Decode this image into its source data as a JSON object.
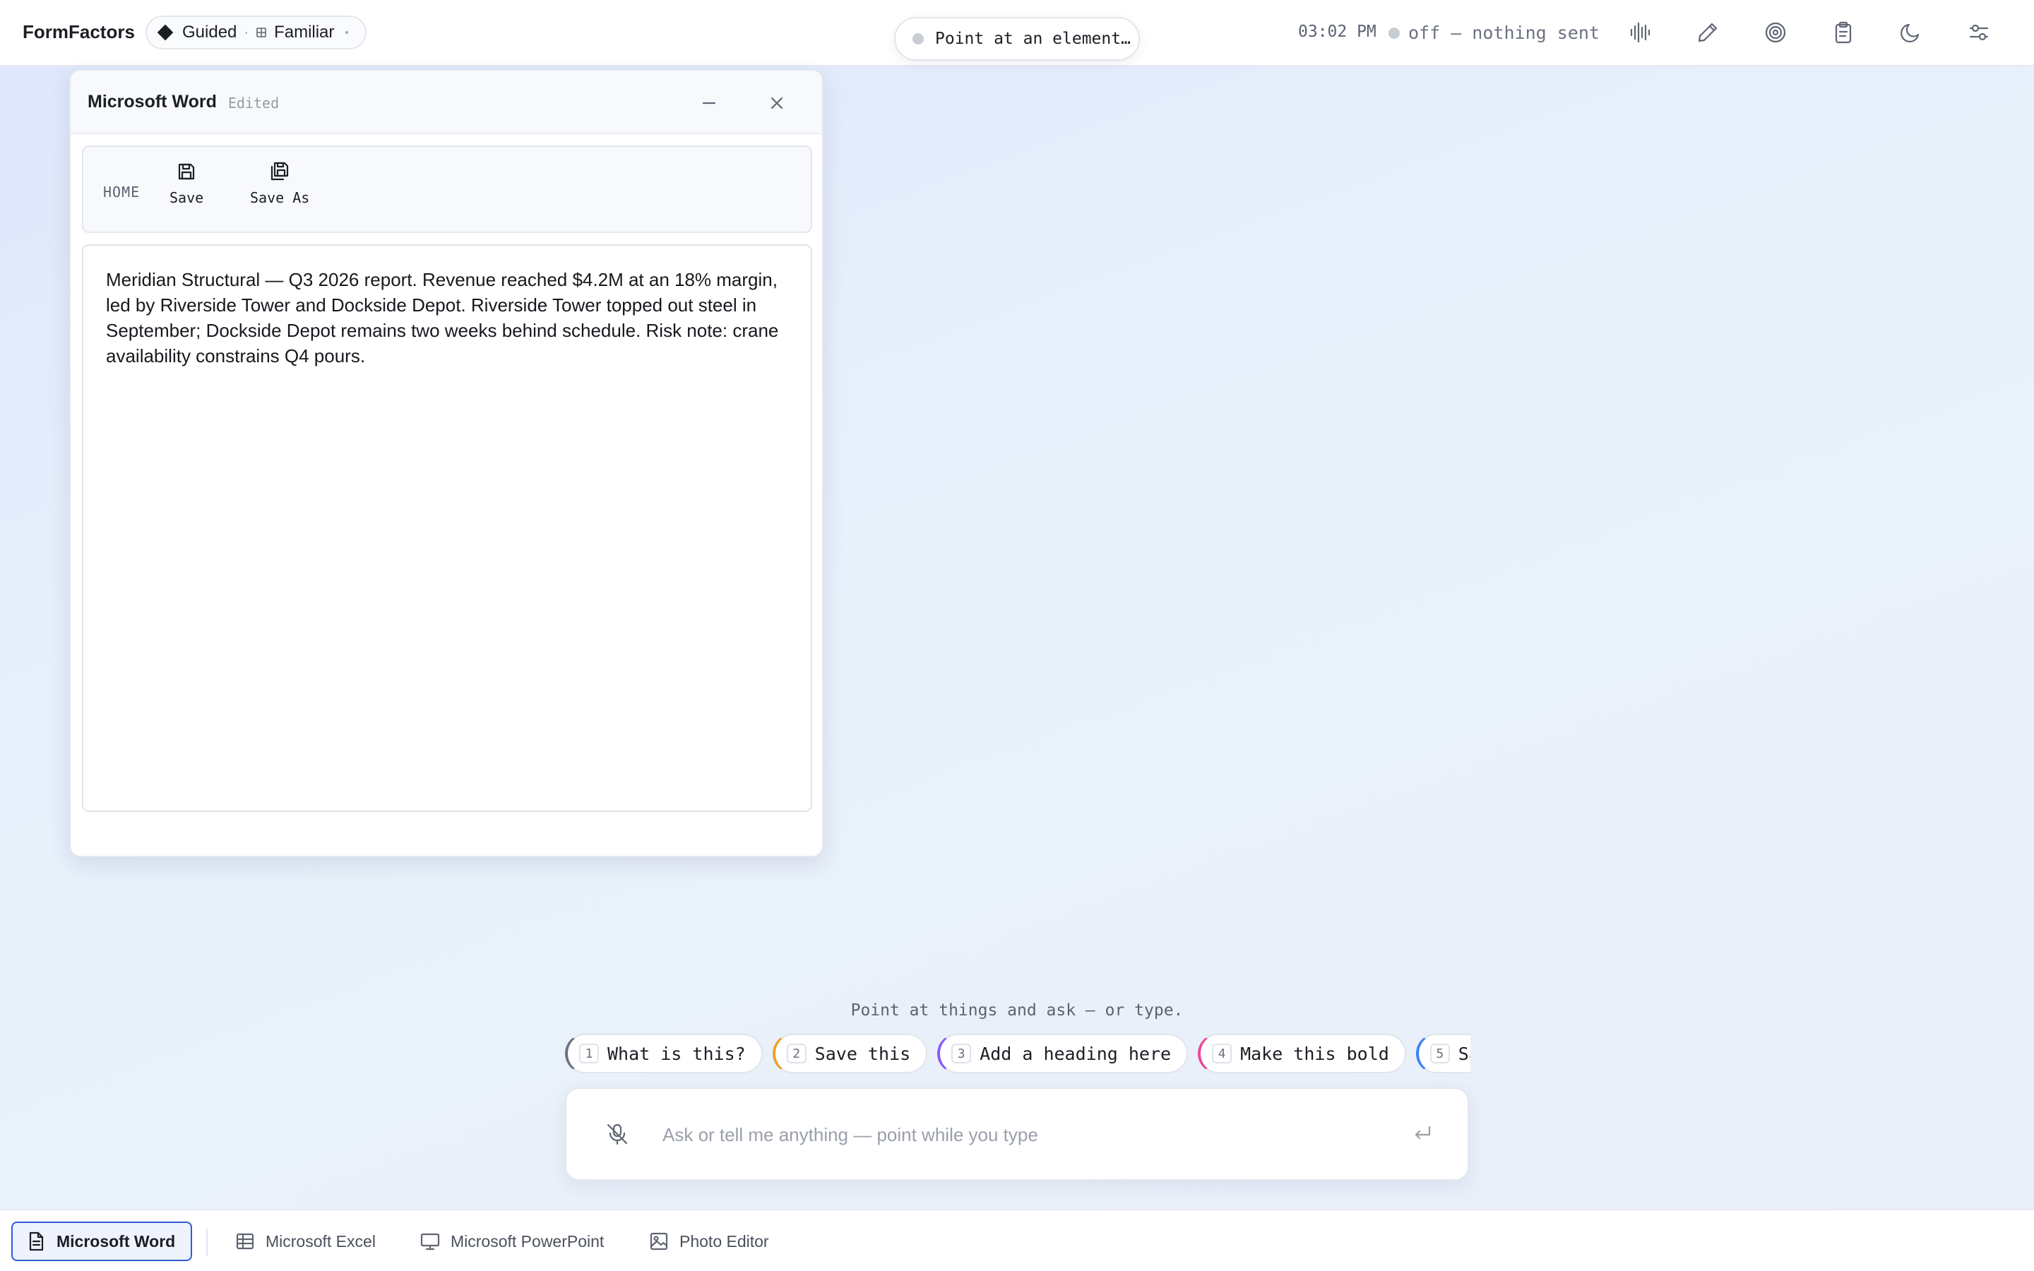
{
  "topbar": {
    "brand": "FormFactors",
    "mode": {
      "primary": "Guided",
      "secondary": "Familiar"
    },
    "pointer_prompt": "Point at an element…",
    "clock": "03:02 PM",
    "status": "off – nothing sent",
    "tools": [
      "audio-waveform-icon",
      "pen-icon",
      "target-icon",
      "clipboard-icon",
      "moon-icon",
      "sliders-icon"
    ]
  },
  "window": {
    "title": "Microsoft Word",
    "state": "Edited",
    "ribbon": {
      "tab": "HOME",
      "save_label": "Save",
      "save_as_label": "Save As"
    },
    "document_text": "Meridian Structural — Q3 2026 report. Revenue reached $4.2M at an 18% margin, led by Riverside Tower and Dockside Depot. Riverside Tower topped out steel in September; Dockside Depot remains two weeks behind schedule. Risk note: crane availability constrains Q4 pours."
  },
  "prompt": {
    "hint": "Point at things and ask – or type.",
    "suggestions": [
      {
        "num": "1",
        "label": "What is this?",
        "color": "#6b7280"
      },
      {
        "num": "2",
        "label": "Save this",
        "color": "#f0a020"
      },
      {
        "num": "3",
        "label": "Add a heading here",
        "color": "#8b5cf6"
      },
      {
        "num": "4",
        "label": "Make this bold",
        "color": "#ec4899"
      },
      {
        "num": "5",
        "label": "Save as",
        "color": "#3b82f6"
      }
    ],
    "input_placeholder": "Ask or tell me anything — point while you type"
  },
  "taskbar": {
    "apps": [
      {
        "label": "Microsoft Word",
        "active": true
      },
      {
        "label": "Microsoft Excel",
        "active": false
      },
      {
        "label": "Microsoft PowerPoint",
        "active": false
      },
      {
        "label": "Photo Editor",
        "active": false
      }
    ]
  }
}
